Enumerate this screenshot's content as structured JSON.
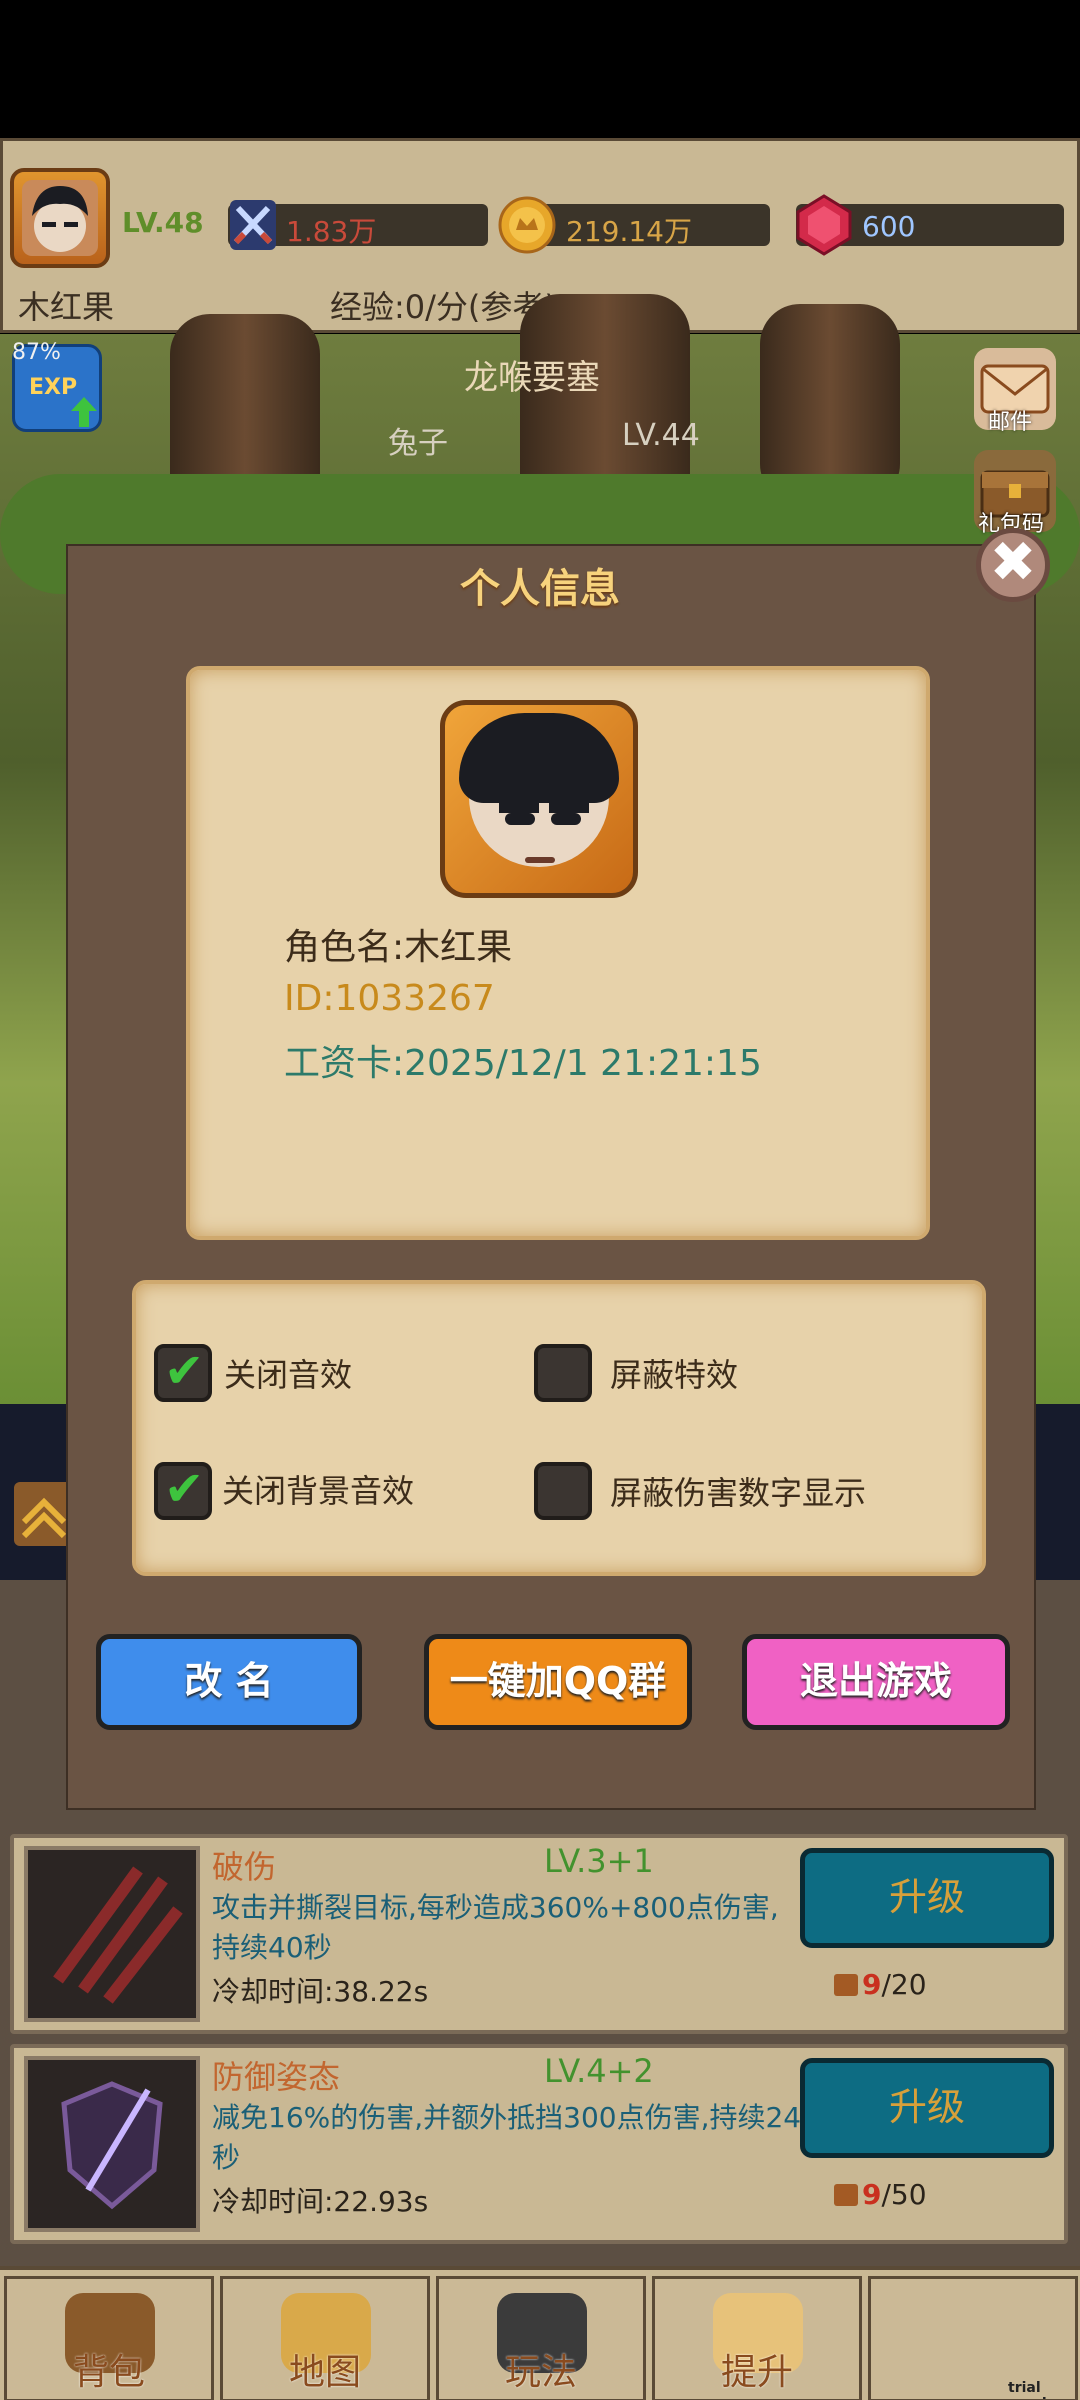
{
  "header": {
    "player_level": "LV.48",
    "power": "1.83万",
    "gold": "219.14万",
    "gems": "600",
    "player_name": "木红果",
    "exp_rate": "经验:0/分(参考)"
  },
  "scene": {
    "map_name": "龙喉要塞",
    "enemy_name": "兔子",
    "enemy_level": "LV.44",
    "exp_percent": "87%",
    "exp_badge": "EXP",
    "mail_label": "邮件",
    "gift_label": "礼包码"
  },
  "modal": {
    "title": "个人信息",
    "close_glyph": "✖",
    "name_line": "角色名:木红果",
    "id_line": "ID:1033267",
    "salary_line": "工资卡:2025/12/1 21:21:15",
    "options": [
      {
        "label": "关闭音效",
        "checked": true
      },
      {
        "label": "屏蔽特效",
        "checked": false
      },
      {
        "label": "关闭背景音效",
        "checked": true
      },
      {
        "label": "屏蔽伤害数字显示",
        "checked": false
      }
    ],
    "checkmark_glyph": "✔",
    "rename_label": "改 名",
    "qq_label": "一键加QQ群",
    "exit_label": "退出游戏"
  },
  "skills": [
    {
      "name": "破伤",
      "level": "LV.3+1",
      "desc": "攻击并撕裂目标,每秒造成360%+800点伤害,持续40秒",
      "cooldown": "冷却时间:38.22s",
      "button": "升级",
      "books_have": "9",
      "books_need": "/20"
    },
    {
      "name": "防御姿态",
      "level": "LV.4+2",
      "desc": "减免16%的伤害,并额外抵挡300点伤害,持续24秒",
      "cooldown": "冷却时间:22.93s",
      "button": "升级",
      "books_have": "9",
      "books_need": "/50"
    }
  ],
  "nav": {
    "tabs": [
      "背包",
      "地图",
      "玩法",
      "提升"
    ]
  },
  "footer": {
    "trial": "trial version"
  },
  "colors": {
    "rename": "#3f8dec",
    "qq": "#ee8a18",
    "exit": "#f061c4",
    "upgrade": "#0d6c83"
  }
}
